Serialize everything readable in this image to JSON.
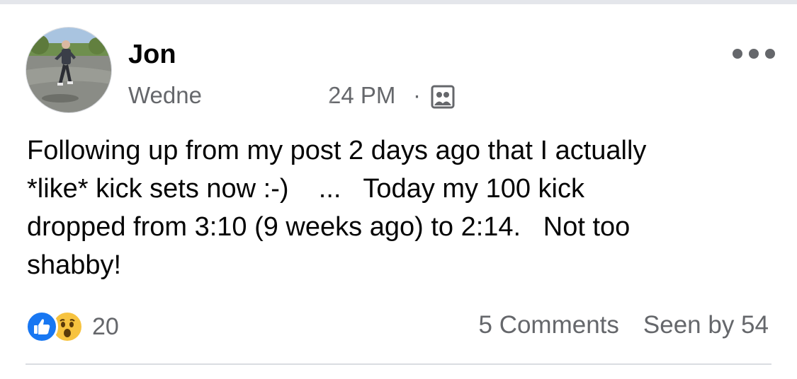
{
  "post": {
    "author_name": "Jon",
    "timestamp_start": "Wedne",
    "timestamp_end": "24 PM",
    "separator": "·",
    "audience_icon": "friends-group-icon",
    "text": "Following up from my post 2 days ago that I actually\n*like* kick sets now :-)    ...   Today my 100 kick\ndropped from 3:10 (9 weeks ago) to 2:14.   Not too\nshabby!",
    "reactions": {
      "icons": [
        "like-icon",
        "wow-icon"
      ],
      "count": "20"
    },
    "comments_label": "5 Comments",
    "seen_label": "Seen by 54"
  },
  "colors": {
    "like_blue": "#1877f2",
    "wow_yellow": "#f7c33f",
    "secondary_text": "#65676b"
  }
}
